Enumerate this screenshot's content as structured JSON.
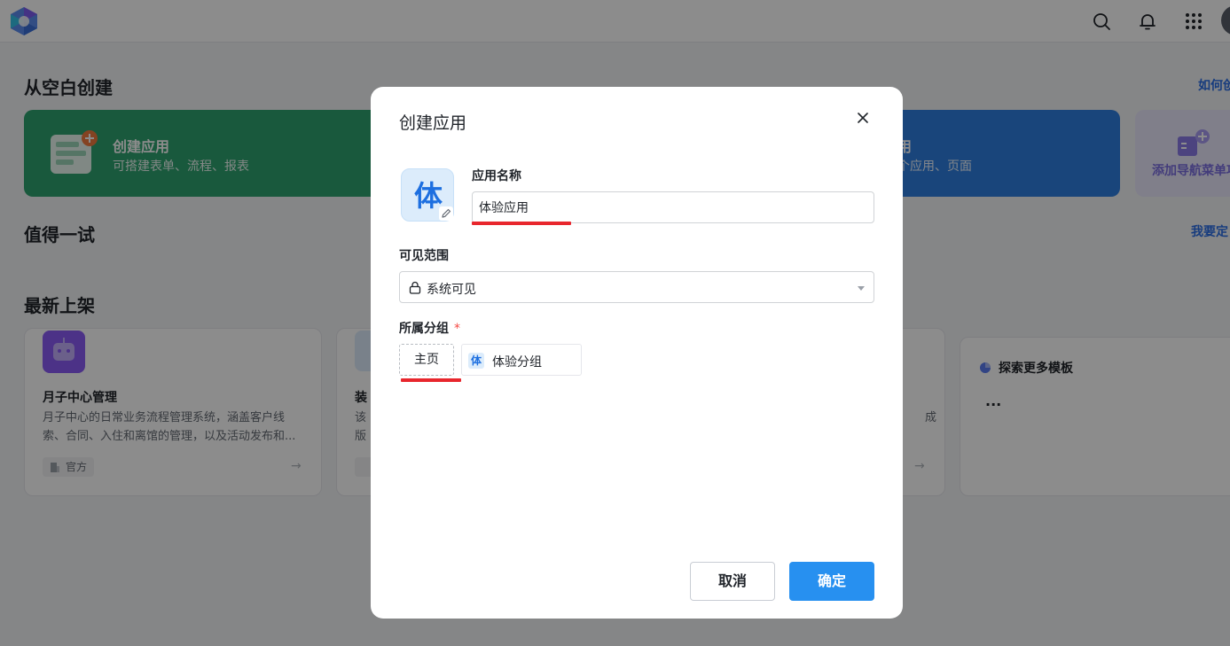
{
  "header": {
    "icons": [
      "search-icon",
      "bell-icon",
      "apps-grid-icon"
    ]
  },
  "page": {
    "blank_section_title": "从空白创建",
    "blank_section_link": "如何创",
    "create_app_card": {
      "title": "创建应用",
      "subtitle": "可搭建表单、流程、报表"
    },
    "blue_card": {
      "title": "用",
      "subtitle": "个应用、页面"
    },
    "nav_card": {
      "title": "添加导航菜单项"
    },
    "try_section_title": "值得一试",
    "try_section_link": "我要定",
    "latest_section_title": "最新上架",
    "templates": [
      {
        "title": "月子中心管理",
        "desc": "月子中心的日常业务流程管理系统，涵盖客户线索、合同、入住和离馆的管理，以及活动发布和...",
        "tag": "官方"
      },
      {
        "title": "装",
        "desc_1": "该",
        "desc_2": "版",
        "tag": ""
      },
      {
        "desc": "成"
      }
    ],
    "explore_card": {
      "title": "探索更多模板",
      "more": "···"
    }
  },
  "modal": {
    "title": "创建应用",
    "app_icon_char": "体",
    "app_name_label": "应用名称",
    "app_name_value": "体验应用",
    "visibility_label": "可见范围",
    "visibility_value": "系统可见",
    "group_label": "所属分组",
    "required_mark": "*",
    "group_home": "主页",
    "group_item": {
      "icon_char": "体",
      "label": "体验分组"
    },
    "cancel_label": "取消",
    "confirm_label": "确定"
  },
  "colors": {
    "primary": "#2790f0",
    "green_card": "#2fa26f",
    "blue_card": "#2e7fe0",
    "highlight": "#e8262d",
    "required": "#f54a45"
  }
}
